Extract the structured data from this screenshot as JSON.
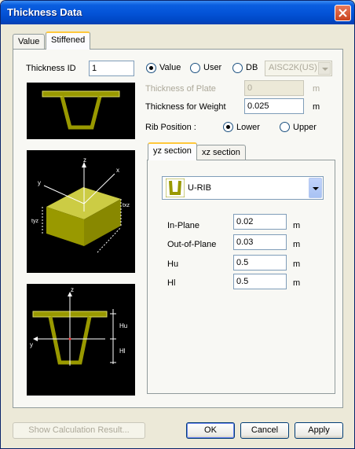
{
  "window": {
    "title": "Thickness Data"
  },
  "tabs": {
    "value": "Value",
    "stiffened": "Stiffened"
  },
  "form": {
    "thickness_id_label": "Thickness ID",
    "thickness_id_value": "1",
    "source_value": "Value",
    "source_user": "User",
    "source_db": "DB",
    "db_combo": "AISC2K(US)",
    "thickness_of_plate_label": "Thickness of Plate",
    "thickness_of_plate_value": "0",
    "thickness_of_plate_unit": "m",
    "thickness_for_weight_label": "Thickness for Weight",
    "thickness_for_weight_value": "0.025",
    "thickness_for_weight_unit": "m",
    "rib_position_label": "Rib Position :",
    "rib_lower": "Lower",
    "rib_upper": "Upper",
    "selected_source": "Value",
    "selected_rib_position": "Lower"
  },
  "section_tabs": {
    "yz": "yz section",
    "xz": "xz section"
  },
  "section": {
    "rib_type": "U-RIB",
    "fields": [
      {
        "label": "In-Plane",
        "value": "0.02",
        "unit": "m"
      },
      {
        "label": "Out-of-Plane",
        "value": "0.03",
        "unit": "m"
      },
      {
        "label": "Hu",
        "value": "0.5",
        "unit": "m"
      },
      {
        "label": "Hl",
        "value": "0.5",
        "unit": "m"
      }
    ]
  },
  "diagram": {
    "axis_z": "z",
    "axis_x": "x",
    "axis_y": "y",
    "txz": "txz",
    "tyz": "tyz",
    "hu": "Hu",
    "hl": "Hl"
  },
  "buttons": {
    "show_calc": "Show Calculation Result...",
    "ok": "OK",
    "cancel": "Cancel",
    "apply": "Apply"
  },
  "colors": {
    "rib_fill": "#999900",
    "titlebar": "#0454d8"
  }
}
